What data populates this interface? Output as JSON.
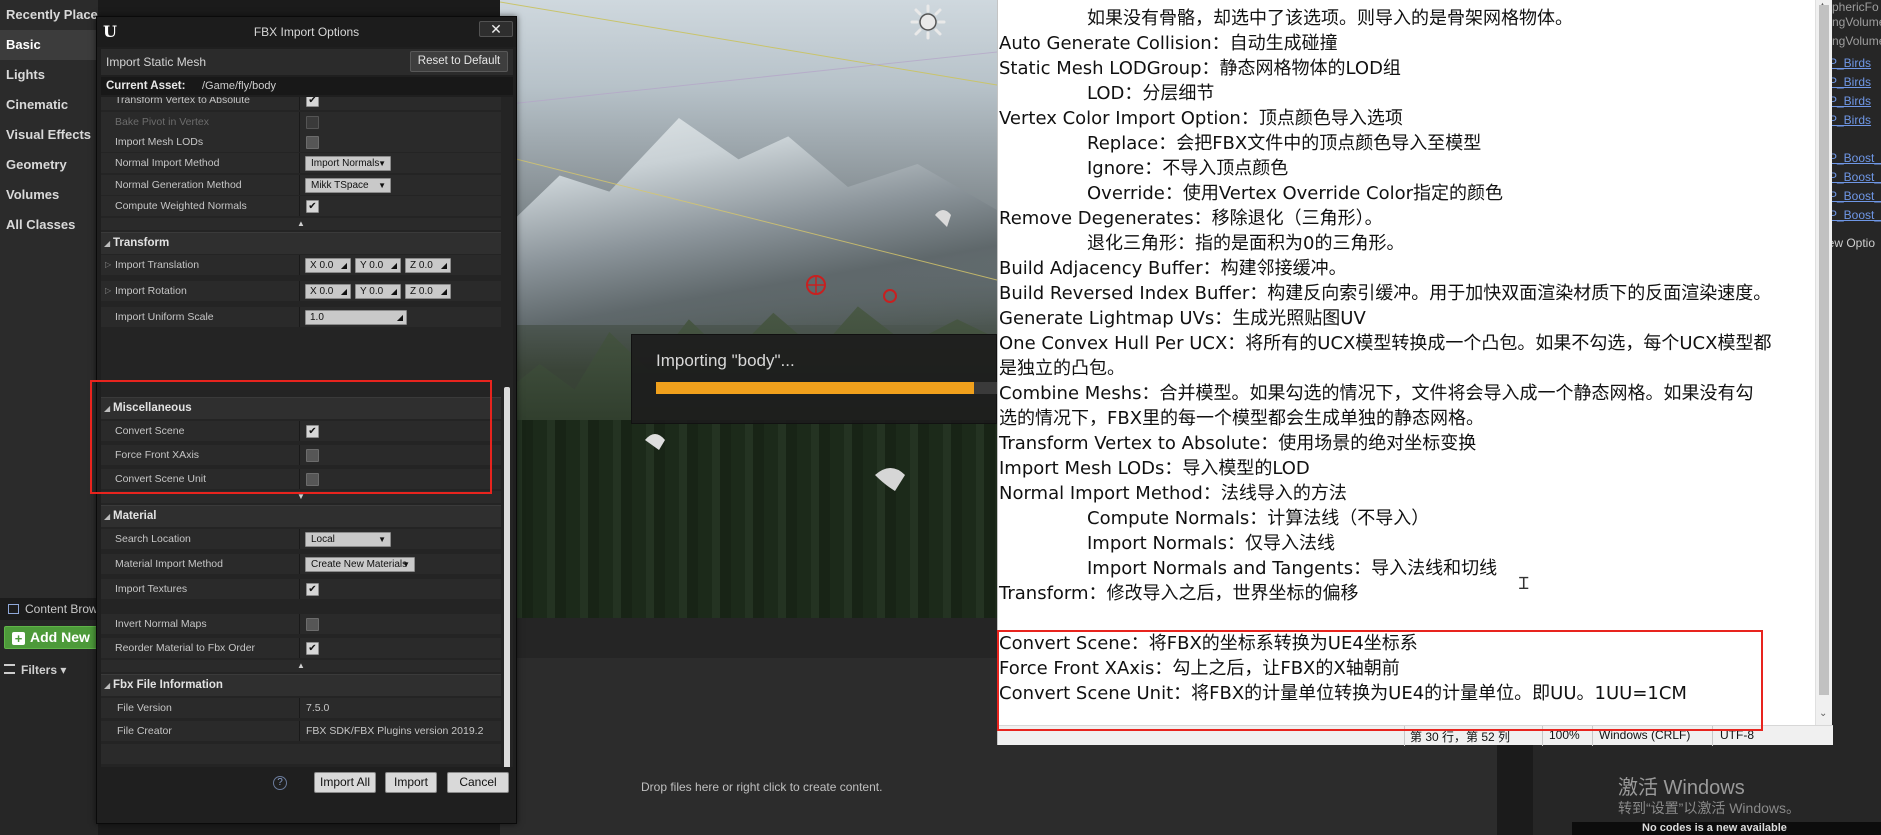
{
  "modes": {
    "items": [
      {
        "label": "Recently Placed"
      },
      {
        "label": "Basic"
      },
      {
        "label": "Lights"
      },
      {
        "label": "Cinematic"
      },
      {
        "label": "Visual Effects"
      },
      {
        "label": "Geometry"
      },
      {
        "label": "Volumes"
      },
      {
        "label": "All Classes"
      }
    ],
    "active": "Basic"
  },
  "content_browser": {
    "tab_label": "Content Brow",
    "add_new_label": "Add New",
    "filters_label": "Filters",
    "drop_hint": "Drop files here or right click to create content."
  },
  "viewport": {
    "progress_label": "Importing \"body\"...",
    "progress_fraction": 0.93
  },
  "right_panel": {
    "gray_labels": [
      "phericFo",
      "ngVolume",
      "ngVolume"
    ],
    "asset_links": [
      "P_Birds",
      "P_Birds",
      "P_Birds",
      "P_Birds",
      "P_Boost_",
      "P_Boost_",
      "P_Boost_",
      "P_Boost_"
    ],
    "view_options": "iew Optio",
    "watermark_title": "激活 Windows",
    "watermark_sub": "转到“设置”以激活 Windows。",
    "bottom_bar_text": "No codes is a new available"
  },
  "fbx": {
    "title": "FBX Import Options",
    "header_label": "Import Static Mesh",
    "reset_label": "Reset to Default",
    "current_asset_label": "Current Asset:",
    "current_asset_path": "/Game/fly/body",
    "rows_top": [
      {
        "name": "Transform Vertex to Absolute",
        "checked": true,
        "dim": false
      },
      {
        "name": "Bake Pivot in Vertex",
        "checked": false,
        "dim": true
      },
      {
        "name": "Import Mesh LODs",
        "checked": false,
        "dim": false
      }
    ],
    "normal_import_method": {
      "name": "Normal Import Method",
      "value": "Import Normals"
    },
    "normal_generation_method": {
      "name": "Normal Generation Method",
      "value": "Mikk TSpace"
    },
    "compute_weighted_normals": {
      "name": "Compute Weighted Normals",
      "checked": true
    },
    "transform": {
      "title": "Transform",
      "import_translation": {
        "name": "Import Translation",
        "x": "0.0",
        "y": "0.0",
        "z": "0.0"
      },
      "import_rotation": {
        "name": "Import Rotation",
        "x": "0.0",
        "y": "0.0",
        "z": "0.0"
      },
      "import_uniform_scale": {
        "name": "Import Uniform Scale",
        "value": "1.0"
      }
    },
    "axis_labels": {
      "x": "X",
      "y": "Y",
      "z": "Z"
    },
    "misc": {
      "title": "Miscellaneous",
      "convert_scene": {
        "name": "Convert Scene",
        "checked": true
      },
      "force_front_xaxis": {
        "name": "Force Front XAxis",
        "checked": false
      },
      "convert_scene_unit": {
        "name": "Convert Scene Unit",
        "checked": false
      }
    },
    "material": {
      "title": "Material",
      "search_location": {
        "name": "Search Location",
        "value": "Local"
      },
      "material_import_method": {
        "name": "Material Import Method",
        "value": "Create New Materials"
      },
      "import_textures": {
        "name": "Import Textures",
        "checked": true
      },
      "invert_normal_maps": {
        "name": "Invert Normal Maps",
        "checked": false
      },
      "reorder_material": {
        "name": "Reorder Material to Fbx Order",
        "checked": true
      }
    },
    "fbx_info": {
      "title": "Fbx File Information",
      "file_version": {
        "name": "File Version",
        "value": "7.5.0"
      },
      "file_creator": {
        "name": "File Creator",
        "value": "FBX SDK/FBX Plugins version 2019.2"
      }
    },
    "buttons": {
      "import_all": "Import All",
      "import": "Import",
      "cancel": "Cancel"
    }
  },
  "notepad": {
    "lines": [
      {
        "text": "如果没有骨骼，却选中了该选项。则导入的是骨架网格物体。",
        "indent": true
      },
      {
        "text": "Auto Generate Collision：自动生成碰撞",
        "indent": false
      },
      {
        "text": "Static Mesh LODGroup：静态网格物体的LOD组",
        "indent": false
      },
      {
        "text": "LOD：分层细节",
        "indent": true
      },
      {
        "text": "Vertex Color Import Option：顶点颜色导入选项",
        "indent": false
      },
      {
        "text": "Replace：会把FBX文件中的顶点颜色导入至模型",
        "indent": true
      },
      {
        "text": "Ignore：不导入顶点颜色",
        "indent": true
      },
      {
        "text": "Override：使用Vertex Override Color指定的颜色",
        "indent": true
      },
      {
        "text": "Remove Degenerates：移除退化（三角形）。",
        "indent": false
      },
      {
        "text": "退化三角形：指的是面积为0的三角形。",
        "indent": true
      },
      {
        "text": "Build Adjacency Buffer：构建邻接缓冲。",
        "indent": false
      },
      {
        "text": "Build Reversed Index Buffer：构建反向索引缓冲。用于加快双面渲染材质下的反面渲染速度。",
        "indent": false
      },
      {
        "text": "Generate Lightmap UVs：生成光照贴图UV",
        "indent": false
      },
      {
        "text": "One Convex Hull Per UCX：将所有的UCX模型转换成一个凸包。如果不勾选，每个UCX模型都",
        "indent": false
      },
      {
        "text": "是独立的凸包。",
        "indent": false
      },
      {
        "text": "Combine Meshs：合并模型。如果勾选的情况下，文件将会导入成一个静态网格。如果没有勾",
        "indent": false
      },
      {
        "text": "选的情况下，FBX里的每一个模型都会生成单独的静态网格。",
        "indent": false
      },
      {
        "text": "Transform Vertex to Absolute：使用场景的绝对坐标变换",
        "indent": false
      },
      {
        "text": "Import Mesh LODs：导入模型的LOD",
        "indent": false
      },
      {
        "text": "Normal Import Method：法线导入的方法",
        "indent": false
      },
      {
        "text": "Compute Normals：计算法线（不导入）",
        "indent": true
      },
      {
        "text": "Import Normals：仅导入法线",
        "indent": true
      },
      {
        "text": "Import Normals and Tangents：导入法线和切线",
        "indent": true
      },
      {
        "text": "Transform：修改导入之后，世界坐标的偏移",
        "indent": false
      },
      {
        "text": "",
        "indent": false
      },
      {
        "text": "Convert Scene：将FBX的坐标系转换为UE4坐标系",
        "indent": false
      },
      {
        "text": "Force Front XAxis：勾上之后，让FBX的X轴朝前",
        "indent": false
      },
      {
        "text": "Convert Scene Unit：将FBX的计量单位转换为UE4的计量单位。即UU。1UU=1CM",
        "indent": false
      }
    ],
    "status": {
      "position": "第 30 行，第 52 列",
      "zoom": "100%",
      "line_ending": "Windows (CRLF)",
      "encoding": "UTF-8"
    }
  },
  "colors": {
    "highlight": "#e8241e",
    "progress": "#f0a01c",
    "add_new": "#4d9a3a",
    "link": "#6f97e6"
  }
}
